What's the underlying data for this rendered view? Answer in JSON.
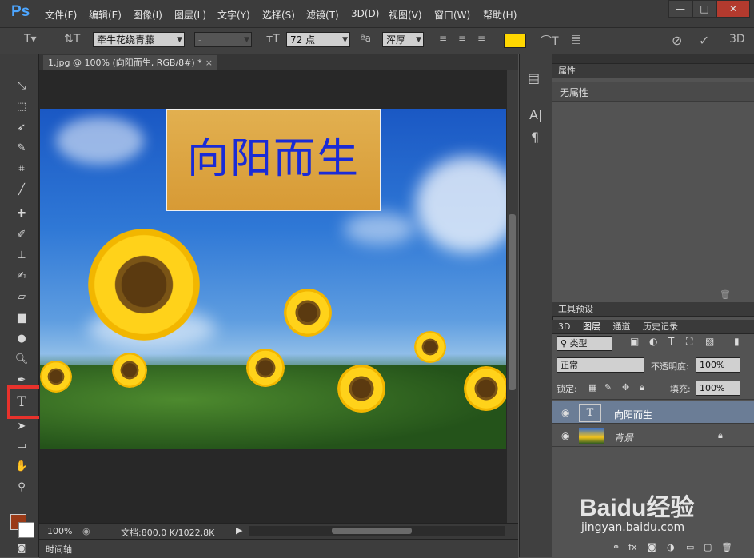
{
  "app": {
    "logo": "Ps"
  },
  "menu": [
    "文件(F)",
    "编辑(E)",
    "图像(I)",
    "图层(L)",
    "文字(Y)",
    "选择(S)",
    "滤镜(T)",
    "3D(D)",
    "视图(V)",
    "窗口(W)",
    "帮助(H)"
  ],
  "window_controls": {
    "minimize": "—",
    "maximize": "□",
    "close": "✕"
  },
  "options": {
    "font_family": "牵牛花绕青藤",
    "font_style": "-",
    "font_size": "72 点",
    "aa_label": "ªa",
    "antialias": "浑厚",
    "text_color": "#ffd700"
  },
  "document": {
    "tab_title": "1.jpg @ 100% (向阳而生, RGB/8#) *",
    "canvas_text": "向阳而生",
    "zoom": "100%",
    "doc_size": "文档:800.0 K/1022.8K"
  },
  "timeline": {
    "label": "时间轴"
  },
  "properties": {
    "tab": "属性",
    "content": "无属性"
  },
  "tool_presets": {
    "tab": "工具预设"
  },
  "layers_panel": {
    "tabs": [
      "3D",
      "图层",
      "通道",
      "历史记录"
    ],
    "kind_filter": "类型",
    "blend_mode": "正常",
    "opacity_label": "不透明度:",
    "opacity_value": "100%",
    "lock_label": "锁定:",
    "fill_label": "填充:",
    "fill_value": "100%",
    "layers": [
      {
        "name": "向阳而生",
        "type": "text",
        "selected": true
      },
      {
        "name": "背景",
        "type": "image",
        "locked": true
      }
    ]
  },
  "watermark": {
    "brand": "Baidu经验",
    "url": "jingyan.baidu.com"
  },
  "colors": {
    "foreground": "#9a3a17",
    "background": "#ffffff",
    "highlight": "#e8322c"
  }
}
